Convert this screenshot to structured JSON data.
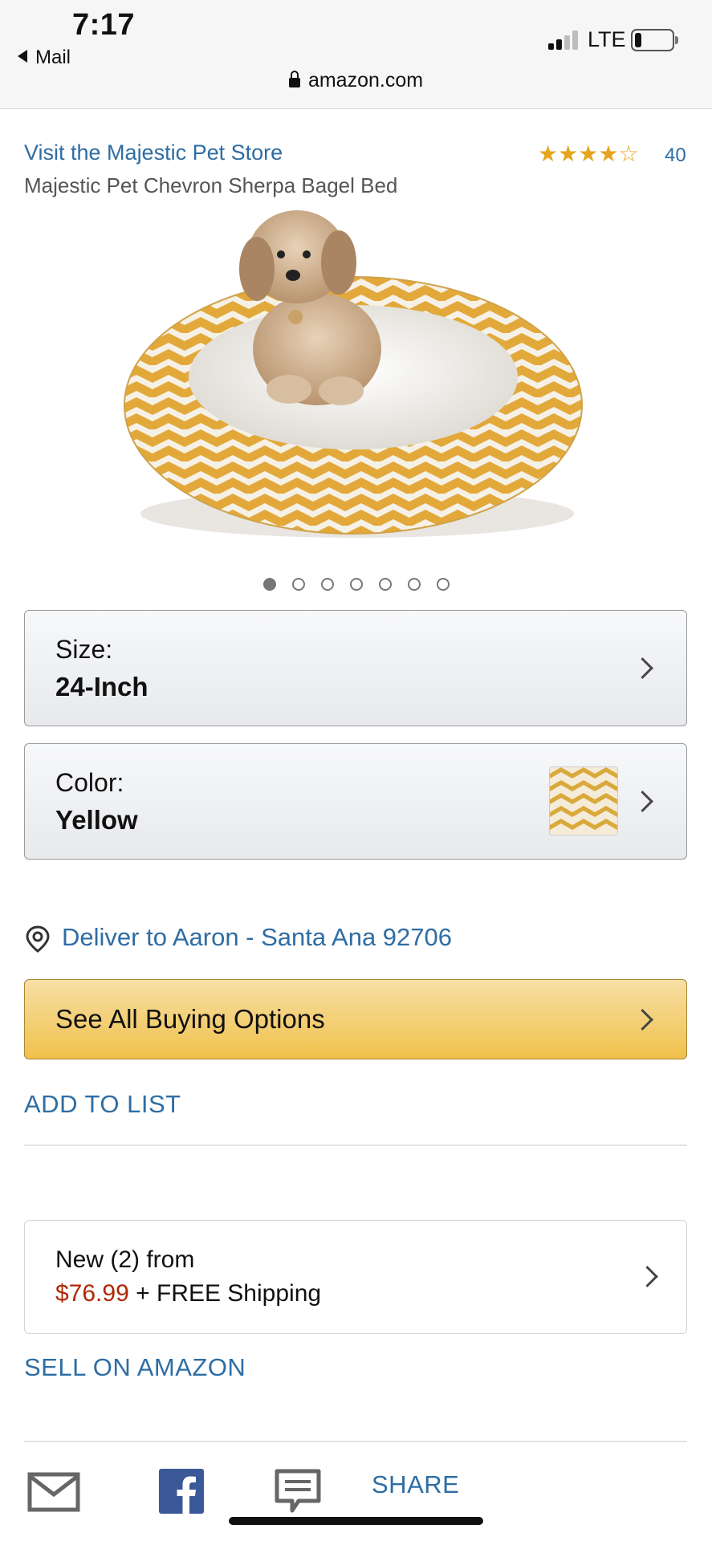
{
  "status_bar": {
    "time": "7:17",
    "back_app": "Mail",
    "network": "LTE",
    "url": "amazon.com"
  },
  "product": {
    "store_link": "Visit the Majestic Pet Store",
    "rating_stars": 4,
    "review_count": "40",
    "title": "Majestic Pet Chevron Sherpa Bagel Bed",
    "image_count": 7,
    "active_image": 1
  },
  "size_selector": {
    "label": "Size:",
    "value": "24-Inch"
  },
  "color_selector": {
    "label": "Color:",
    "value": "Yellow",
    "swatch_color": "#d9a93c"
  },
  "delivery": {
    "text": "Deliver to Aaron - Santa Ana 92706"
  },
  "buy_button": {
    "label": "See All Buying Options"
  },
  "add_to_list": "ADD TO LIST",
  "offer": {
    "line1": "New (2) from",
    "price": "$76.99",
    "shipping": " + FREE Shipping"
  },
  "sell_link": "SELL ON AMAZON",
  "share": {
    "label": "SHARE"
  },
  "colors": {
    "link": "#2e6da4",
    "price": "#b12704",
    "star": "#e6a51c",
    "buy_button": "#f0c14b",
    "facebook": "#3b5998",
    "chevron_fabric": "#e2a93a"
  }
}
